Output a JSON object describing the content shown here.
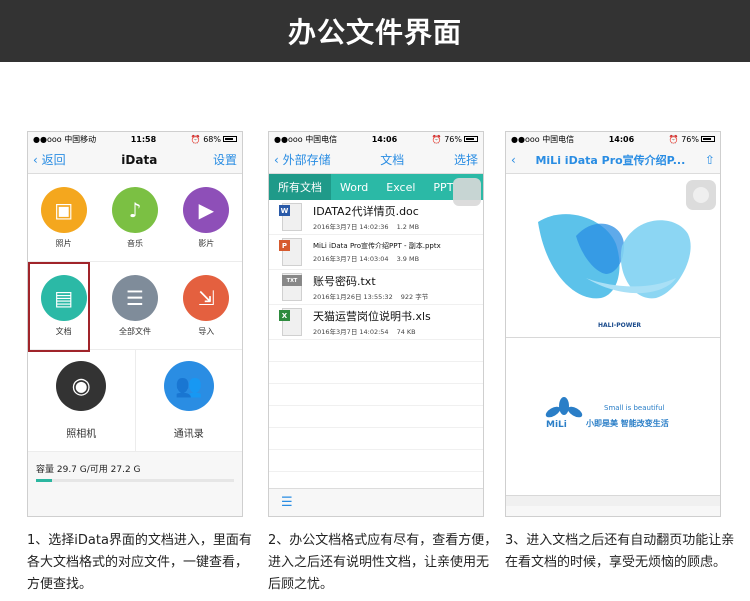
{
  "banner": {
    "title": "办公文件界面"
  },
  "phone1": {
    "status": {
      "left": "●●ooo 中国移动 ",
      "time": "11:58",
      "right": "⏰ 68%"
    },
    "nav": {
      "back": "返回",
      "title": "iData",
      "settings": "设置"
    },
    "grid": [
      {
        "label": "照片",
        "color": "#f4a71e",
        "icon": "photo-icon",
        "glyph": "▣"
      },
      {
        "label": "音乐",
        "color": "#7bc043",
        "icon": "music-icon",
        "glyph": "♪"
      },
      {
        "label": "影片",
        "color": "#8e4fb8",
        "icon": "film-icon",
        "glyph": "▶"
      },
      {
        "label": "文档",
        "color": "#2bb9a6",
        "icon": "document-icon",
        "glyph": "▤"
      },
      {
        "label": "全部文件",
        "color": "#7f8c9a",
        "icon": "all-files-icon",
        "glyph": "☰"
      },
      {
        "label": "导入",
        "color": "#e4603f",
        "icon": "import-icon",
        "glyph": "⇲"
      }
    ],
    "big": [
      {
        "label": "照相机",
        "color": "#333333",
        "icon": "camera-icon",
        "glyph": "◉"
      },
      {
        "label": "通讯录",
        "color": "#2a8de3",
        "icon": "contacts-icon",
        "glyph": "👥"
      }
    ],
    "storage": {
      "text": "容量 29.7 G/可用 27.2 G",
      "used_fraction": 0.08
    }
  },
  "phone2": {
    "status": {
      "left": "●●ooo 中国电信 ",
      "time": "14:06",
      "right": "⏰ 76%"
    },
    "nav": {
      "back": "外部存储",
      "title": "文档",
      "select": "选择"
    },
    "tabs": [
      "所有文档",
      "Word",
      "Excel",
      "PPT"
    ],
    "files": [
      {
        "name": "IDATA2代详情页.doc",
        "date": "2016年3月7日 14:02:36",
        "size": "1.2 MB",
        "type": "W",
        "color": "#2a5aa8",
        "icon": "word-file-icon",
        "small": false
      },
      {
        "name": "MiLi iData Pro宣传介绍PPT - 副本.pptx",
        "date": "2016年3月7日 14:03:04",
        "size": "3.9 MB",
        "type": "P",
        "color": "#d65a2e",
        "icon": "ppt-file-icon",
        "small": true
      },
      {
        "name": "账号密码.txt",
        "date": "2016年1月26日 13:55:32",
        "size": "922 字节",
        "type": "TXT",
        "color": "#888888",
        "icon": "txt-file-icon",
        "small": false
      },
      {
        "name": "天猫运营岗位说明书.xls",
        "date": "2016年3月7日 14:02:54",
        "size": "74 KB",
        "type": "X",
        "color": "#2e8b3e",
        "icon": "excel-file-icon",
        "small": false
      }
    ]
  },
  "phone3": {
    "status": {
      "left": "●●ooo 中国电信 ",
      "time": "14:06",
      "right": "⏰ 76%"
    },
    "nav": {
      "title": "MiLi iData Pro宣传介绍P..."
    },
    "slide1": {
      "brand": "HALI-POWER"
    },
    "slide2": {
      "tagline_en": "Small is beautiful",
      "logo_text": "MiLi",
      "slogan": "小即是美  智能改变生活"
    }
  },
  "captions": [
    "1、选择iData界面的文档进入，里面有各大文档格式的对应文件，一键查看，方便查找。",
    "2、办公文档格式应有尽有，查看方便，进入之后还有说明性文档，让亲使用无后顾之忧。",
    "3、进入文档之后还有自动翻页功能让亲在看文档的时候，享受无烦恼的顾虑。"
  ]
}
